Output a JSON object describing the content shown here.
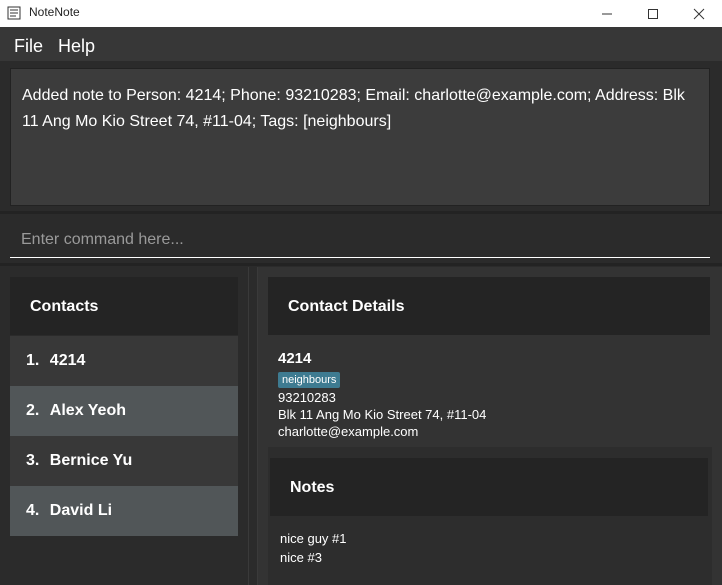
{
  "window": {
    "title": "NoteNote",
    "icon": "notebook-icon",
    "controls": [
      "minimize-icon",
      "maximize-icon",
      "close-icon"
    ]
  },
  "menu": {
    "items": [
      "File",
      "Help"
    ]
  },
  "result": {
    "text": "Added note to Person: 4214; Phone: 93210283; Email: charlotte@example.com; Address: Blk 11 Ang Mo Kio Street 74, #11-04; Tags: [neighbours]"
  },
  "command": {
    "placeholder": "Enter command here...",
    "value": ""
  },
  "contacts": {
    "header": "Contacts",
    "items": [
      {
        "index": "1.",
        "name": "4214"
      },
      {
        "index": "2.",
        "name": "Alex Yeoh"
      },
      {
        "index": "3.",
        "name": "Bernice Yu"
      },
      {
        "index": "4.",
        "name": "David Li"
      }
    ]
  },
  "details": {
    "header": "Contact Details",
    "name": "4214",
    "tag": "neighbours",
    "phone": "93210283",
    "address": "Blk 11 Ang Mo Kio Street 74, #11-04",
    "email": "charlotte@example.com"
  },
  "notes": {
    "header": "Notes",
    "items": [
      "nice guy #1",
      "nice #3"
    ]
  },
  "colors": {
    "background": "#2b2b2b",
    "header": "#242424",
    "tag": "#3e7b91",
    "row_selected": "#515658"
  }
}
